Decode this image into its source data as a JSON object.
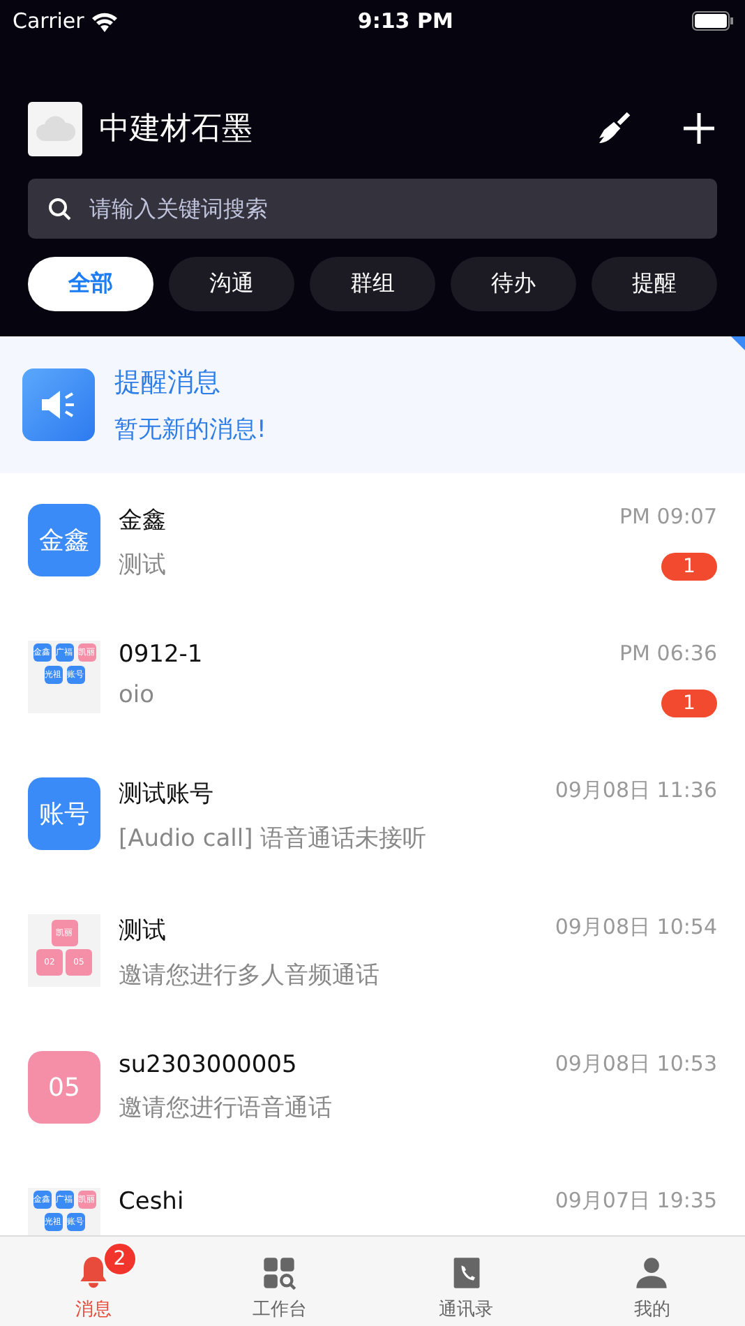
{
  "status_bar": {
    "carrier": "Carrier",
    "time": "9:13 PM"
  },
  "header": {
    "title": "中建材石墨",
    "search": {
      "placeholder": "请输入关键词搜索"
    }
  },
  "filters": [
    {
      "label": "全部",
      "selected": true
    },
    {
      "label": "沟通",
      "selected": false
    },
    {
      "label": "群组",
      "selected": false
    },
    {
      "label": "待办",
      "selected": false
    },
    {
      "label": "提醒",
      "selected": false
    }
  ],
  "reminder": {
    "title": "提醒消息",
    "subtitle": "暂无新的消息!"
  },
  "conversations": [
    {
      "avatar": {
        "kind": "text",
        "label": "金鑫",
        "color": "#3a8af7"
      },
      "name": "金鑫",
      "preview": "测试",
      "time": "PM 09:07",
      "unread": "1"
    },
    {
      "avatar": {
        "kind": "group",
        "tiles": [
          {
            "label": "金鑫",
            "color": "#3a8af7"
          },
          {
            "label": "广福",
            "color": "#3a8af7"
          },
          {
            "label": "凯丽",
            "color": "#f58fa8"
          },
          {
            "label": "光祖",
            "color": "#3a8af7"
          },
          {
            "label": "账号",
            "color": "#3a8af7"
          }
        ]
      },
      "name": "0912-1",
      "preview": "oio",
      "time": "PM 06:36",
      "unread": "1"
    },
    {
      "avatar": {
        "kind": "text",
        "label": "账号",
        "color": "#3a8af7"
      },
      "name": "测试账号",
      "preview": "[Audio call] 语音通话未接听",
      "time": "09月08日 11:36"
    },
    {
      "avatar": {
        "kind": "pyramid",
        "tiles": [
          {
            "label": "凯丽",
            "color": "#f58fa8"
          },
          {
            "label": "02",
            "color": "#f58fa8"
          },
          {
            "label": "05",
            "color": "#f58fa8"
          }
        ]
      },
      "name": "测试",
      "preview": "邀请您进行多人音频通话",
      "time": "09月08日 10:54"
    },
    {
      "avatar": {
        "kind": "text",
        "label": "05",
        "color": "#f58fa8"
      },
      "name": "su2303000005",
      "preview": "邀请您进行语音通话",
      "time": "09月08日 10:53"
    },
    {
      "avatar": {
        "kind": "group",
        "tiles": [
          {
            "label": "金鑫",
            "color": "#3a8af7"
          },
          {
            "label": "广福",
            "color": "#3a8af7"
          },
          {
            "label": "凯丽",
            "color": "#f58fa8"
          },
          {
            "label": "光祖",
            "color": "#3a8af7"
          },
          {
            "label": "账号",
            "color": "#3a8af7"
          }
        ]
      },
      "name": "Ceshi",
      "time": "09月07日 19:35"
    }
  ],
  "tab_bar": [
    {
      "label": "消息",
      "selected": true,
      "badge": "2"
    },
    {
      "label": "工作台",
      "selected": false
    },
    {
      "label": "通讯录",
      "selected": false
    },
    {
      "label": "我的",
      "selected": false
    }
  ]
}
